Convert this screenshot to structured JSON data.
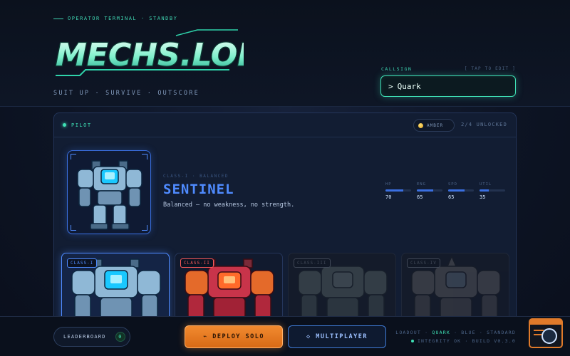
{
  "header": {
    "status_line": "OPERATOR TERMINAL · STANDBY",
    "logo_text": "MECHS.LOL",
    "tagline": "SUIT UP · SURVIVE · OUTSCORE",
    "callsign_label": "CALLSIGN",
    "callsign_hint": "[ TAP TO EDIT ]",
    "callsign_prompt": ">",
    "callsign_value": "Quark"
  },
  "pilot_panel": {
    "label": "PILOT",
    "currency_label": "AMBER",
    "unlocked_text": "2/4 UNLOCKED",
    "featured": {
      "class_line": "CLASS-I · BALANCED",
      "name": "SENTINEL",
      "description": "Balanced — no weakness, no strength.",
      "stats": [
        {
          "label": "HP",
          "value": "70",
          "fraction": 0.7
        },
        {
          "label": "ENG",
          "value": "65",
          "fraction": 0.65
        },
        {
          "label": "SPD",
          "value": "65",
          "fraction": 0.65
        },
        {
          "label": "UTIL",
          "value": "35",
          "fraction": 0.35
        }
      ]
    },
    "cards": [
      {
        "tag": "CLASS-I",
        "selected": true,
        "locked": false,
        "tag_color": "#4f8bff"
      },
      {
        "tag": "CLASS-II",
        "selected": false,
        "locked": false,
        "tag_color": "#ff5a5a"
      },
      {
        "tag": "CLASS-III",
        "selected": false,
        "locked": true,
        "tag_color": "#6f7f95"
      },
      {
        "tag": "CLASS-IV",
        "selected": false,
        "locked": true,
        "tag_color": "#6f7f95"
      }
    ]
  },
  "footer": {
    "leaderboard_label": "LEADERBOARD",
    "leaderboard_count": "0",
    "deploy_label": "⌁ DEPLOY SOLO",
    "multiplayer_label": "◇ MULTIPLAYER",
    "loadout_prefix": "LOADOUT ·",
    "loadout_pilot": "QUARK",
    "loadout_rest": "· BLUE · STANDARD",
    "integrity_text": "INTEGRITY OK · BUILD V0.3.0"
  },
  "colors": {
    "accent_teal": "#3fe0b5",
    "accent_blue": "#4f8bff",
    "accent_orange": "#f28a2f"
  },
  "icons": [
    "amber-coin-icon",
    "status-dot-icon",
    "console-search-icon"
  ]
}
